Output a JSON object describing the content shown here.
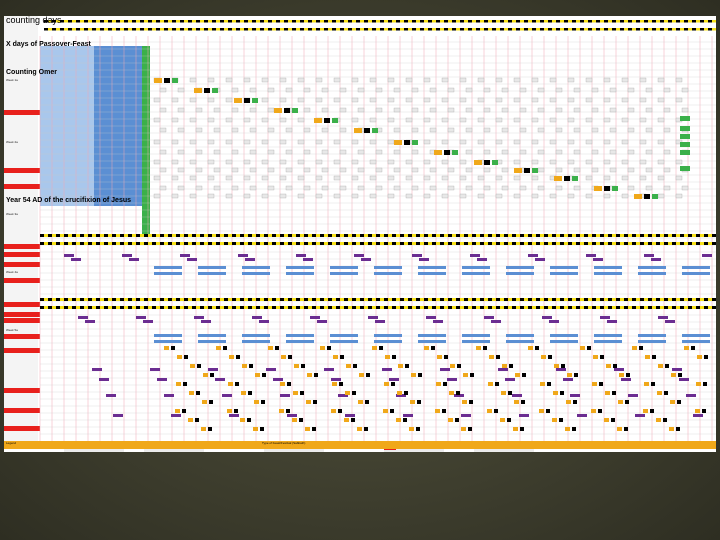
{
  "title": "counting days",
  "section_xdays": "X days of Passover-Feast",
  "section_order": "Counting Omer",
  "section_year": "Year 54 AD of the crucifixion of Jesus",
  "labels": {
    "week1": "Week 1a",
    "week2": "Week 2a",
    "week3": "Week 3a",
    "week4": "Week 4a",
    "week5": "Week 5a"
  },
  "legend": {
    "title": "Legend",
    "col3_header": "Type of Feast/Festival (Sabbath)",
    "colors": {
      "red": "#e8201c",
      "yellow": "#f7e21a",
      "blue": "#5b8fd3",
      "lightblue": "#a9c7ec",
      "green": "#3bb04a",
      "purple": "#6b2d91",
      "orange": "#f0a81a",
      "pink": "#f6c6cf",
      "black": "#000000"
    }
  }
}
